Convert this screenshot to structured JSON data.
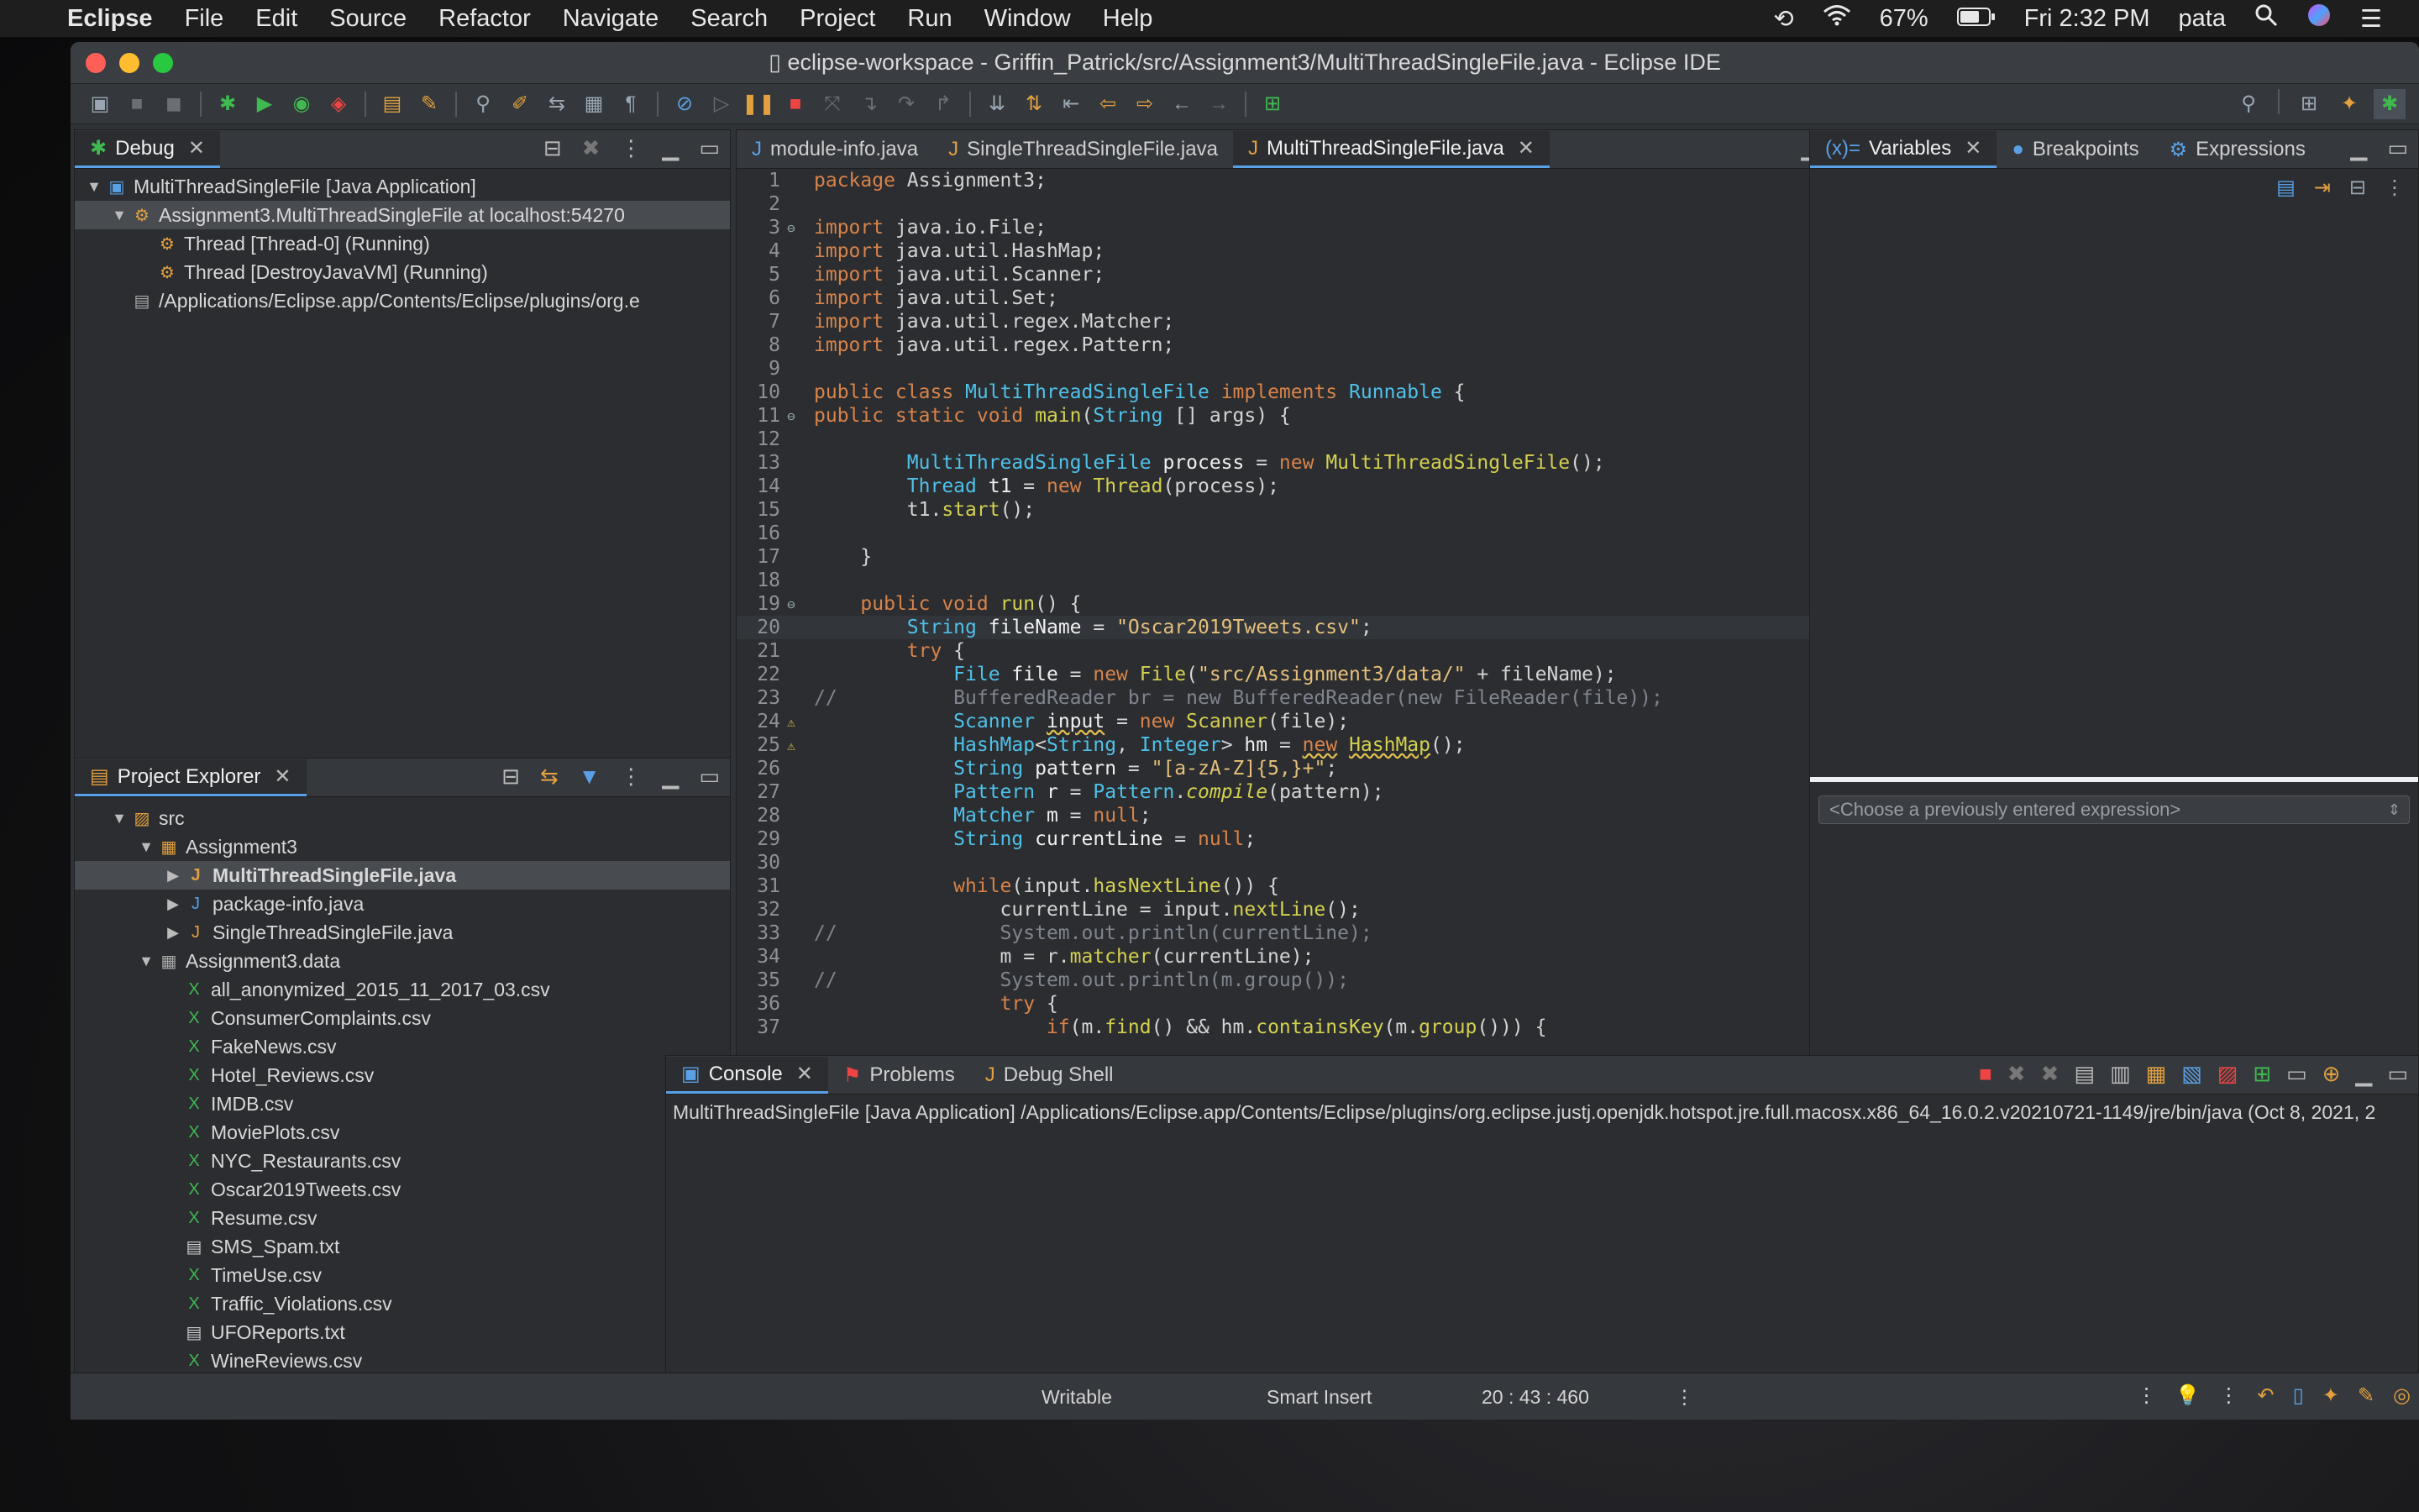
{
  "menubar": {
    "apple_icon": "apple-icon",
    "app_name": "Eclipse",
    "items": [
      "File",
      "Edit",
      "Source",
      "Refactor",
      "Navigate",
      "Search",
      "Project",
      "Run",
      "Window",
      "Help"
    ],
    "battery": "67%",
    "clock": "Fri 2:32 PM",
    "user": "pata"
  },
  "window": {
    "title": "eclipse-workspace - Griffin_Patrick/src/Assignment3/MultiThreadSingleFile.java - Eclipse IDE"
  },
  "debug_view": {
    "tab": "Debug",
    "rows": [
      "MultiThreadSingleFile [Java Application]",
      "Assignment3.MultiThreadSingleFile at localhost:54270",
      "Thread [Thread-0] (Running)",
      "Thread [DestroyJavaVM] (Running)",
      "/Applications/Eclipse.app/Contents/Eclipse/plugins/org.e"
    ]
  },
  "project_explorer": {
    "tab": "Project Explorer",
    "rows": [
      "src",
      "Assignment3",
      "MultiThreadSingleFile.java",
      "package-info.java",
      "SingleThreadSingleFile.java",
      "Assignment3.data",
      "all_anonymized_2015_11_2017_03.csv",
      "ConsumerComplaints.csv",
      "FakeNews.csv",
      "Hotel_Reviews.csv",
      "IMDB.csv",
      "MoviePlots.csv",
      "NYC_Restaurants.csv",
      "Oscar2019Tweets.csv",
      "Resume.csv",
      "SMS_Spam.txt",
      "TimeUse.csv",
      "Traffic_Violations.csv",
      "UFOReports.txt",
      "WineReviews.csv"
    ]
  },
  "editor": {
    "tabs": [
      "module-info.java",
      "SingleThreadSingleFile.java",
      "MultiThreadSingleFile.java"
    ],
    "active_tab": 2,
    "line_numbers": [
      "1",
      "2",
      "3",
      "4",
      "5",
      "6",
      "7",
      "8",
      "9",
      "10",
      "11",
      "12",
      "13",
      "14",
      "15",
      "16",
      "17",
      "18",
      "19",
      "20",
      "21",
      "22",
      "23",
      "24",
      "25",
      "26",
      "27",
      "28",
      "29",
      "30",
      "31",
      "32",
      "33",
      "34",
      "35",
      "36",
      "37"
    ]
  },
  "right_panel": {
    "tabs": [
      "Variables",
      "Breakpoints",
      "Expressions"
    ],
    "expression_placeholder": "<Choose a previously entered expression>"
  },
  "console": {
    "tabs": [
      "Console",
      "Problems",
      "Debug Shell"
    ],
    "launch_line": "MultiThreadSingleFile [Java Application] /Applications/Eclipse.app/Contents/Eclipse/plugins/org.eclipse.justj.openjdk.hotspot.jre.full.macosx.x86_64_16.0.2.v20210721-1149/jre/bin/java  (Oct 8, 2021, 2"
  },
  "statusbar": {
    "mode": "Writable",
    "insert": "Smart Insert",
    "position": "20 : 43 : 460"
  },
  "colors": {
    "keyword": "#d8834a",
    "type": "#4fc1e9",
    "string": "#e6c07b",
    "comment": "#7f848e",
    "accent": "#5aa0e6"
  }
}
